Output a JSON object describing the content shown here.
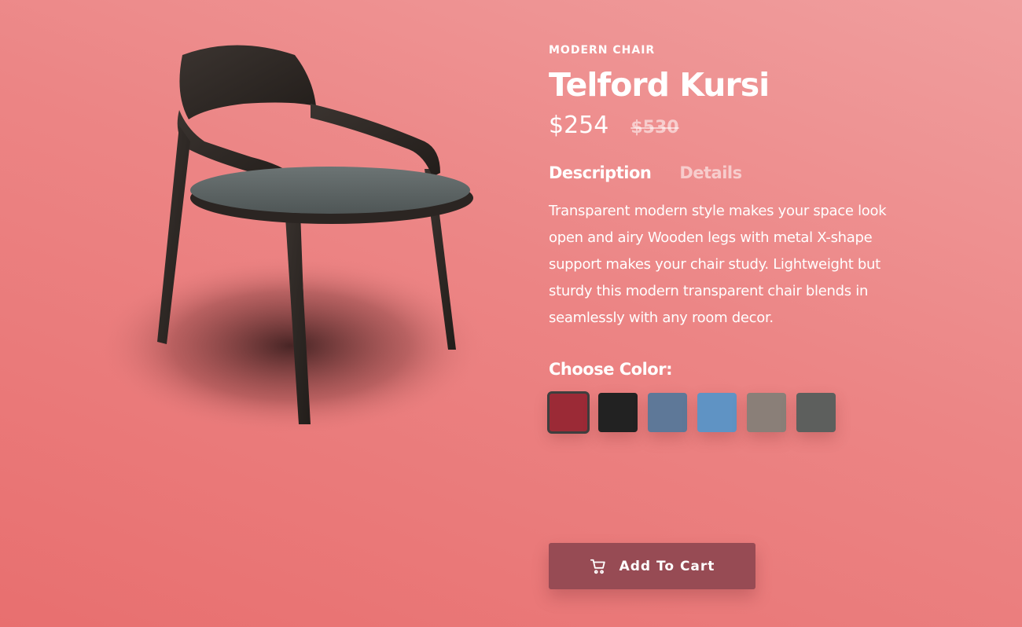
{
  "product": {
    "category": "MODERN CHAIR",
    "name": "Telford Kursi",
    "price": "$254",
    "old_price": "$530"
  },
  "tabs": [
    {
      "label": "Description",
      "active": true
    },
    {
      "label": "Details",
      "active": false
    }
  ],
  "description": "Transparent modern style makes your space look open and airy Wooden legs with metal X-shape support makes your chair study. Lightweight but sturdy this modern transparent chair blends in seamlessly with any room decor.",
  "color_picker": {
    "label": "Choose Color:",
    "swatches": [
      {
        "color": "#9b2a36",
        "selected": true
      },
      {
        "color": "#222222",
        "selected": false
      },
      {
        "color": "#5e7898",
        "selected": false
      },
      {
        "color": "#5f93c4",
        "selected": false
      },
      {
        "color": "#8a7f78",
        "selected": false
      },
      {
        "color": "#5d5f5d",
        "selected": false
      }
    ]
  },
  "cart_button": {
    "label": "Add To Cart",
    "icon": "cart-icon",
    "color": "#974b54"
  }
}
